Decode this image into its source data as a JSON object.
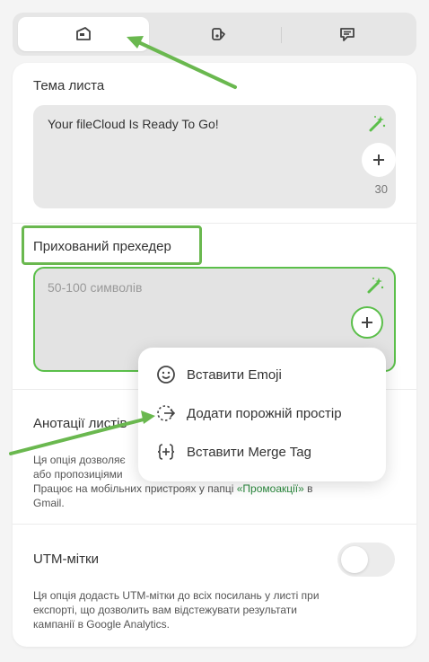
{
  "tabs": [
    {
      "icon": "email-content-icon",
      "active": true
    },
    {
      "icon": "design-tag-icon",
      "active": false
    },
    {
      "icon": "comment-icon",
      "active": false
    }
  ],
  "subject": {
    "label": "Тема листа",
    "value": "Your fileCloud Is Ready To Go!",
    "counter": "30"
  },
  "preheader": {
    "label": "Прихований прехедер",
    "placeholder": "50-100 символів"
  },
  "annotations": {
    "label": "Анотації листів",
    "desc_line1": "Ця опція дозволяє",
    "desc_line2": "або пропозиціями",
    "desc_line3_pre": "Працює на мобільних пристроях у папці ",
    "desc_link": "«Промоакції»",
    "desc_line3_post": " в",
    "desc_line4": "Gmail."
  },
  "utm": {
    "label": "UTM-мітки",
    "toggle_on": false,
    "desc_line1": "Ця опція додасть UTM-мітки до всіх посилань у листі при",
    "desc_line2": "експорті, що дозволить вам відстежувати результати",
    "desc_line3": "кампанії в Google Analytics."
  },
  "menu": {
    "items": [
      {
        "icon": "emoji-icon",
        "label": "Вставити Emoji"
      },
      {
        "icon": "empty-space-icon",
        "label": "Додати порожній простір"
      },
      {
        "icon": "merge-tag-icon",
        "label": "Вставити Merge Tag"
      }
    ]
  },
  "colors": {
    "accent_green": "#5bbf4a",
    "link_green": "#2b8a3e",
    "annotation_arrow": "#6ab84f"
  }
}
